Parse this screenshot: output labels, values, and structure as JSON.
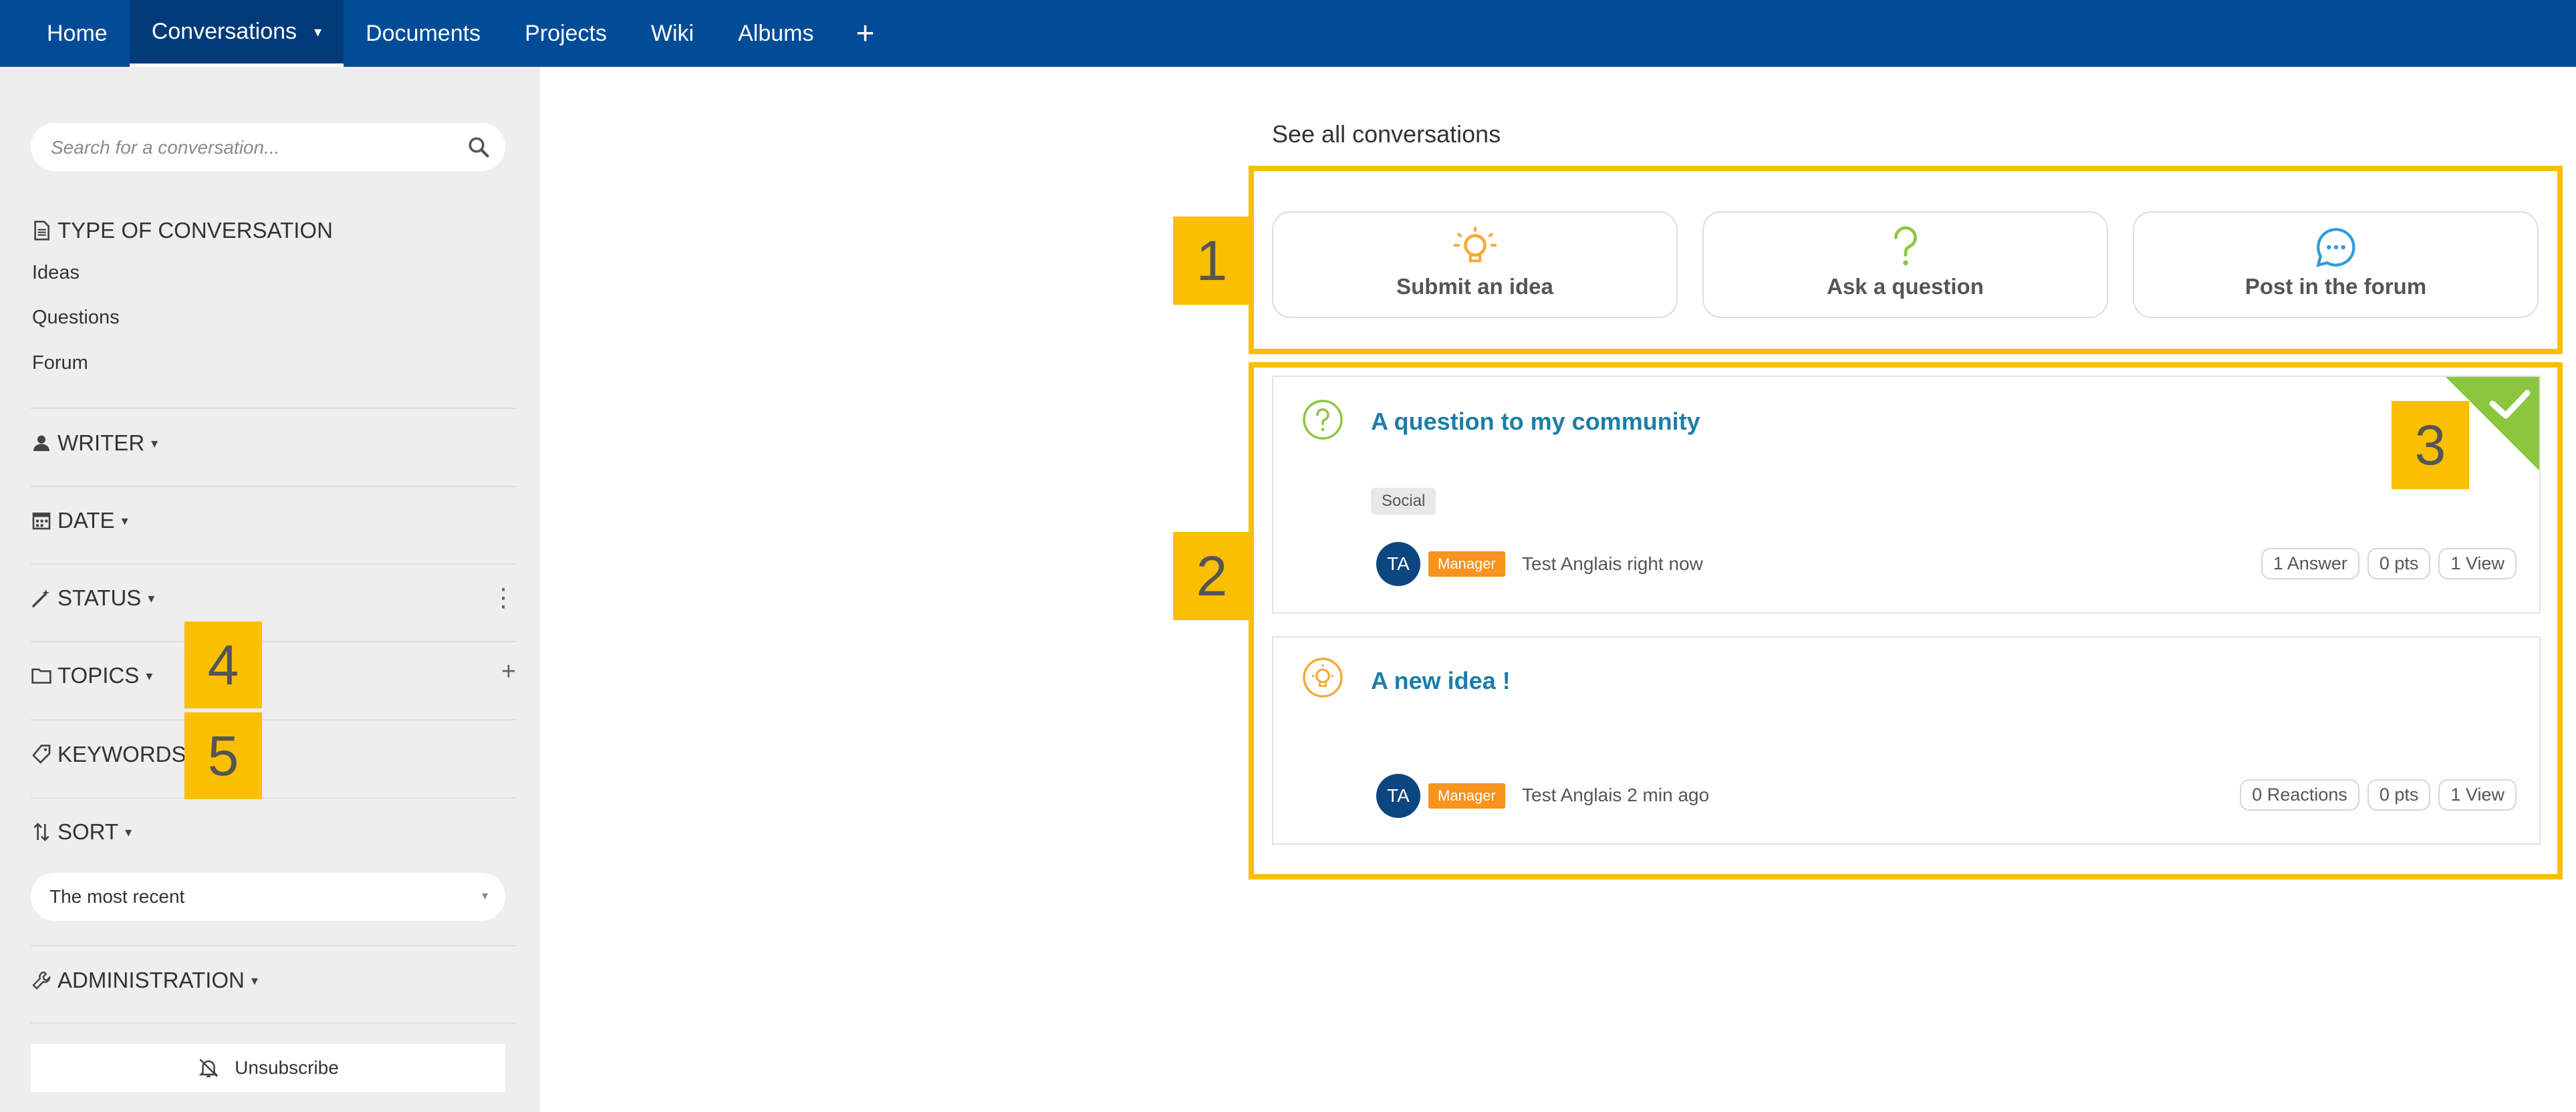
{
  "topnav": {
    "items": [
      {
        "label": "Home"
      },
      {
        "label": "Conversations"
      },
      {
        "label": "Documents"
      },
      {
        "label": "Projects"
      },
      {
        "label": "Wiki"
      },
      {
        "label": "Albums"
      }
    ],
    "active": "Conversations",
    "caret": "▾",
    "add_label": "+"
  },
  "sidebar": {
    "search": {
      "placeholder": "Search for a conversation...",
      "value": ""
    },
    "type_heading": "TYPE OF CONVERSATION",
    "types": [
      "Ideas",
      "Questions",
      "Forum"
    ],
    "writer_heading": "WRITER",
    "date_heading": "DATE",
    "status_heading": "STATUS",
    "topics_heading": "TOPICS",
    "keywords_heading": "KEYWORDS",
    "sort_heading": "SORT",
    "sort_value": "The most recent",
    "admin_heading": "ADMINISTRATION",
    "unsubscribe_label": "Unsubscribe",
    "caret": "▾",
    "more_icon": "⋮",
    "plus_icon": "+",
    "dropdown_arrow": "▾"
  },
  "main": {
    "see_all": "See all conversations",
    "actions": [
      {
        "label": "Submit an idea",
        "icon": "lightbulb-icon"
      },
      {
        "label": "Ask a question",
        "icon": "question-mark-icon"
      },
      {
        "label": "Post in the forum",
        "icon": "chat-bubble-icon"
      }
    ],
    "posts": [
      {
        "title": "A question to my community",
        "tag": "Social",
        "avatar": "TA",
        "role": "Manager",
        "meta": "Test Anglais right now",
        "stats": [
          "1 Answer",
          "0 pts",
          "1 View"
        ],
        "solved": true
      },
      {
        "title": "A new idea !",
        "avatar": "TA",
        "role": "Manager",
        "meta": "Test Anglais 2 min ago",
        "stats": [
          "0 Reactions",
          "0 pts",
          "1 View"
        ]
      }
    ]
  },
  "annotations": {
    "m1": "1",
    "m2": "2",
    "m3": "3",
    "m4": "4",
    "m5": "5"
  },
  "colors": {
    "nav_bg": "#004c97",
    "nav_active": "#003a78",
    "sidebar_bg": "#eeeeee",
    "annotation": "#f9bf00",
    "title_link": "#1c7ea8",
    "manager_badge": "#f7931e",
    "avatar": "#0b4680",
    "solved_green": "#8cc63f",
    "idea_orange": "#f7a93b",
    "question_green": "#8cc63f",
    "forum_blue": "#2d9cdb"
  }
}
